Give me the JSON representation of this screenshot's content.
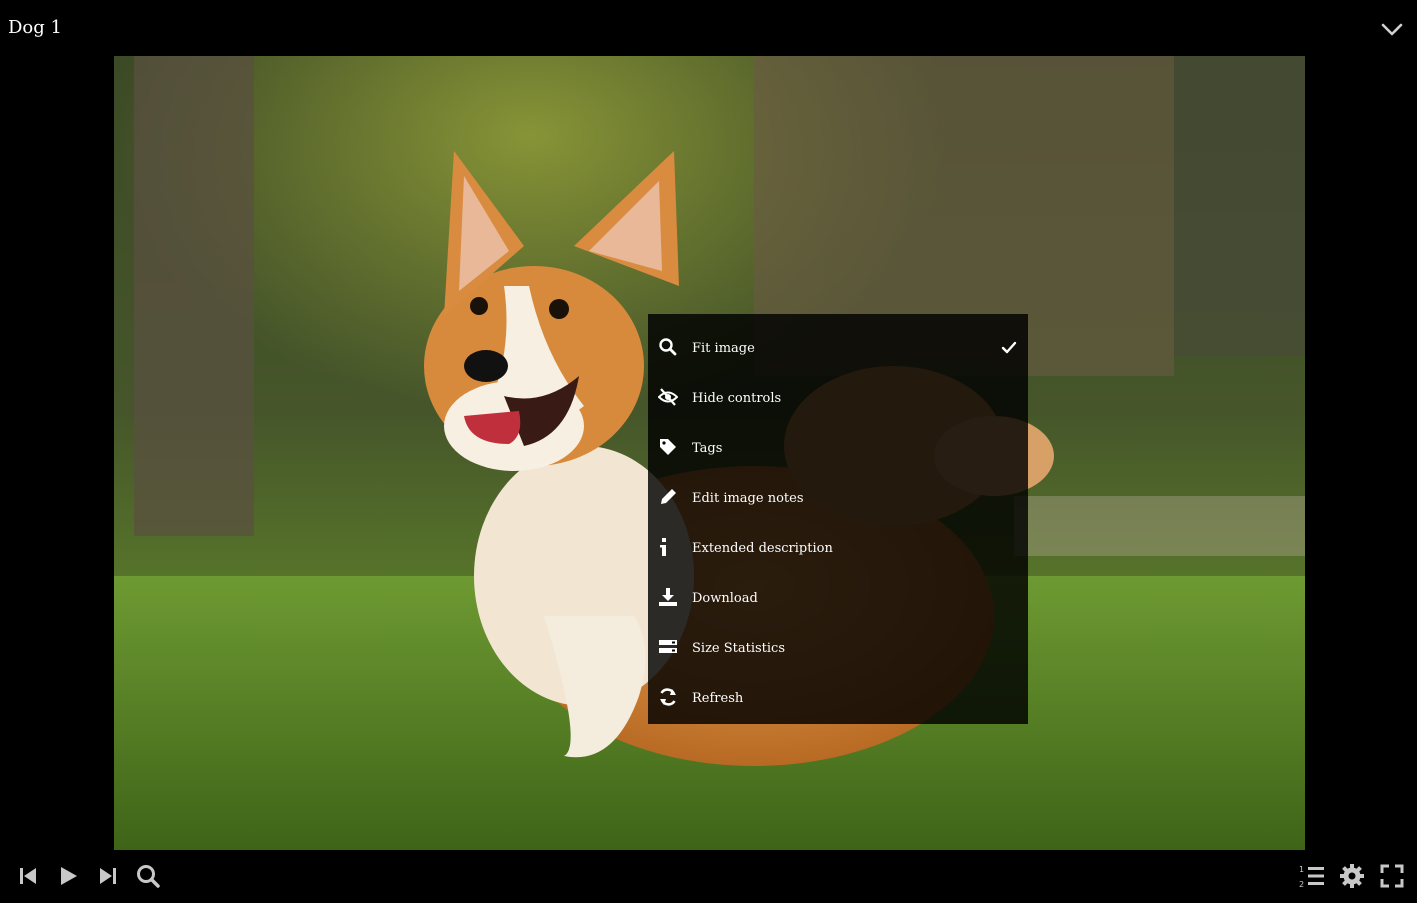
{
  "window": {
    "title": "Dog 1"
  },
  "topbar": {
    "collapse_icon": "chevron-down-icon"
  },
  "image": {
    "alt": "Corgi running on grass"
  },
  "menu": {
    "items": [
      {
        "label": "Fit image",
        "icon": "search-icon",
        "checked": true
      },
      {
        "label": "Hide controls",
        "icon": "eye-slash-icon",
        "checked": false
      },
      {
        "label": "Tags",
        "icon": "tag-icon",
        "checked": false
      },
      {
        "label": "Edit image notes",
        "icon": "pencil-icon",
        "checked": false
      },
      {
        "label": "Extended description",
        "icon": "info-icon",
        "checked": false
      },
      {
        "label": "Download",
        "icon": "download-icon",
        "checked": false
      },
      {
        "label": "Size Statistics",
        "icon": "statistics-icon",
        "checked": false
      },
      {
        "label": "Refresh",
        "icon": "refresh-icon",
        "checked": false
      }
    ]
  },
  "controls": {
    "left": [
      "skip-back-icon",
      "play-icon",
      "skip-forward-icon",
      "zoom-icon"
    ],
    "right": [
      "numbered-list-icon",
      "gear-icon",
      "fullscreen-icon"
    ]
  },
  "colors": {
    "background": "#000000",
    "icon_gray": "#c8c8c8",
    "menu_bg": "#0d0d0d"
  }
}
